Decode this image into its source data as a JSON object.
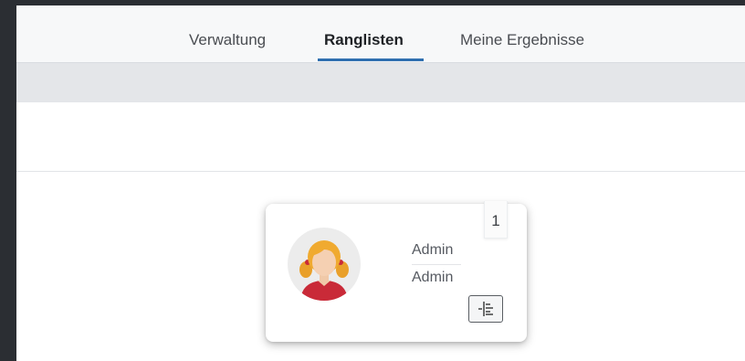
{
  "tabs": [
    {
      "label": "Verwaltung",
      "active": false
    },
    {
      "label": "Ranglisten",
      "active": true
    },
    {
      "label": "Meine Ergebnisse",
      "active": false
    }
  ],
  "colors": {
    "accent": "#2f6fb0",
    "frame": "#2b2e33",
    "toolbar_gray": "#e4e6e9"
  },
  "card": {
    "rank": "1",
    "first_line": "Admin",
    "second_line": "Admin",
    "avatar_icon": "girl-avatar-icon",
    "action_icon": "align-indent-icon"
  }
}
